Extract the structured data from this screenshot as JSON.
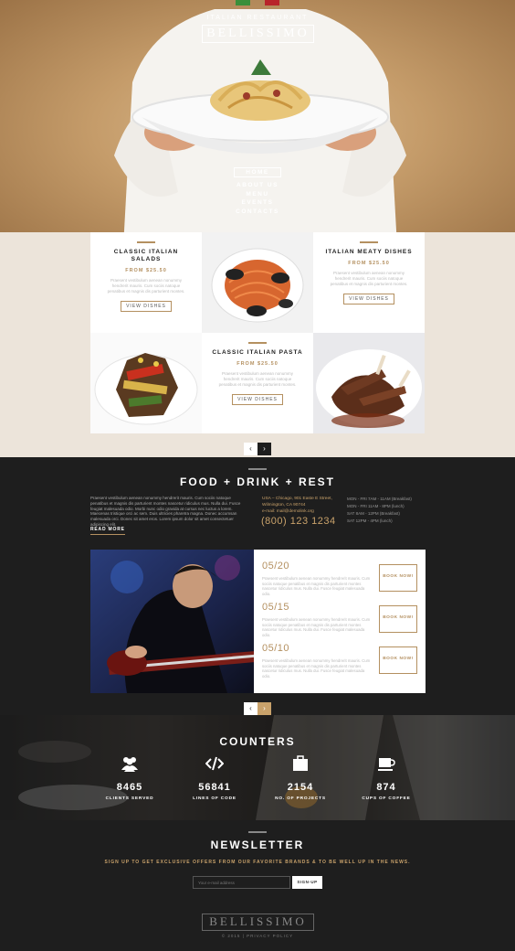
{
  "hero": {
    "subtitle": "ITALIAN RESTAURANT",
    "brand": "BELLISSIMO",
    "nav": [
      "HOME",
      "ABOUT US",
      "MENU",
      "EVENTS",
      "CONTACTS"
    ]
  },
  "menu": {
    "cards": [
      {
        "title": "CLASSIC ITALIAN SALADS",
        "price": "FROM $25.50",
        "desc": "Praesent vestibulum aenean nonummy hendrerit mauris. Cum sociis natoque penatibus et magnis dis parturient montes.",
        "button": "VIEW DISHES"
      },
      {
        "title": "ITALIAN MEATY DISHES",
        "price": "FROM $25.50",
        "desc": "Praesent vestibulum aenean nonummy hendrerit mauris. Cum sociis natoque penatibus et magnis dis parturient montes.",
        "button": "VIEW DISHES"
      },
      {
        "title": "CLASSIC ITALIAN PASTA",
        "price": "FROM $25.50",
        "desc": "Praesent vestibulum aenean nonummy hendrerit mauris. Cum sociis natoque penatibus et magnis dis parturient montes.",
        "button": "VIEW DISHES"
      }
    ],
    "pager": {
      "prev": "‹",
      "next": "›"
    }
  },
  "fdr": {
    "title": "FOOD + DRINK + REST",
    "about": "Praesent vestibulum aenean nonummy hendrerit mauris. Cum sociis natoque penatibus et magnis dis parturient montes nascetur ridiculus mus. Nulla dui. Fusce feugiat malesuada odio. Morbi nunc odio gravida at cursus nec luctus a lorem. Maecenas tristique orci ac sem. Duis ultricies pharetra magna. Donec accumsan malesuada orci. Donec sit amet eros. Lorem ipsum dolor sit amet consectetuer adipiscing elit.",
    "read_more": "READ MORE",
    "address": [
      "USA – Chicago, 901 Easte E Street,",
      "Wilmington, CA 90744",
      "e-mail: mail@demolink.org"
    ],
    "phone": "(800) 123 1234",
    "hours": [
      "MON - FRI 7AM - 11AM (Breakfast)",
      "MON - FRI 11AM - 8PM (lunch)",
      "SAT 8AM - 12PM (Breakfast)",
      "SAT 12PM - 4PM (lunch)"
    ],
    "events": [
      {
        "date": "05/20",
        "text": "Praesent vestibulum aenean nonummy hendrerit mauris. Cum sociis natoque penatibus et magnis dis parturient montes nascetur ridiculus mus. Nulla dui. Fusce feugiat malesuada odio.",
        "book": "BOOK NOW!"
      },
      {
        "date": "05/15",
        "text": "Praesent vestibulum aenean nonummy hendrerit mauris. Cum sociis natoque penatibus et magnis dis parturient montes nascetur ridiculus mus. Nulla dui. Fusce feugiat malesuada odio.",
        "book": "BOOK NOW!"
      },
      {
        "date": "05/10",
        "text": "Praesent vestibulum aenean nonummy hendrerit mauris. Cum sociis natoque penatibus et magnis dis parturient montes nascetur ridiculus mus. Nulla dui. Fusce feugiat malesuada odio.",
        "book": "BOOK NOW!"
      }
    ],
    "pager": {
      "prev": "‹",
      "next": "›"
    }
  },
  "counters": {
    "title": "COUNTERS",
    "items": [
      {
        "icon": "users-icon",
        "num": "8465",
        "label": "CLIENTS SERVED"
      },
      {
        "icon": "code-icon",
        "num": "56841",
        "label": "LINES OF CODE"
      },
      {
        "icon": "briefcase-icon",
        "num": "2154",
        "label": "NO. OF PROJECTS"
      },
      {
        "icon": "coffee-cup-icon",
        "num": "874",
        "label": "CUPS OF COFFEE"
      }
    ]
  },
  "newsletter": {
    "title": "NEWSLETTER",
    "subtitle": "SIGN UP TO GET EXCLUSIVE OFFERS FROM OUR FAVORITE BRANDS & TO BE WELL UP IN THE NEWS.",
    "placeholder": "Your e-mail address",
    "button": "SIGN-UP"
  },
  "footer": {
    "brand": "BELLISSIMO",
    "copyright": "© 2015 | PRIVACY POLICY"
  },
  "colors": {
    "accent": "#b49060",
    "dark": "#1e1e1e",
    "beige": "#ece4da"
  }
}
